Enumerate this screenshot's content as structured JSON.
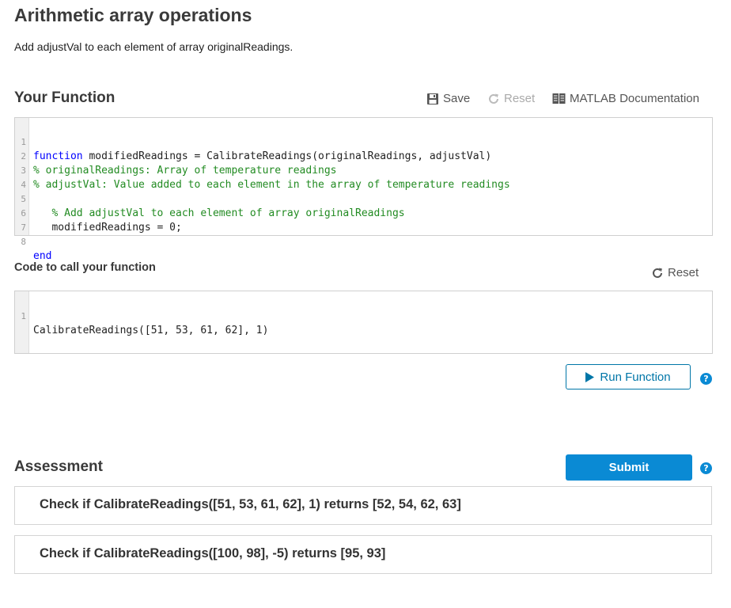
{
  "problem": {
    "title": "Arithmetic array operations",
    "description": "Add adjustVal to each element of array originalReadings."
  },
  "your_function": {
    "heading": "Your Function",
    "save_label": "Save",
    "reset_label": "Reset",
    "docs_label": "MATLAB Documentation",
    "line_numbers": [
      "1",
      "2",
      "3",
      "4",
      "5",
      "6",
      "7",
      "8"
    ],
    "lines": {
      "l1_kw": "function",
      "l1_rest": " modifiedReadings = CalibrateReadings(originalReadings, adjustVal)",
      "l2": "% originalReadings: Array of temperature readings",
      "l3": "% adjustVal: Value added to each element in the array of temperature readings",
      "l4": "",
      "l5": "   % Add adjustVal to each element of array originalReadings",
      "l6": "   modifiedReadings = 0;",
      "l7": "",
      "l8": "end"
    }
  },
  "call_code": {
    "heading": "Code to call your function",
    "reset_label": "Reset",
    "line_numbers": [
      "1"
    ],
    "line1": "CalibrateReadings([51, 53, 61, 62], 1)"
  },
  "run": {
    "label": "Run Function",
    "help": "?"
  },
  "assessment": {
    "heading": "Assessment",
    "submit_label": "Submit",
    "help": "?",
    "tests": [
      {
        "text": "Check if CalibrateReadings([51, 53, 61, 62], 1) returns [52, 54, 62, 63]"
      },
      {
        "text": "Check if CalibrateReadings([100, 98], -5) returns [95, 93]"
      }
    ]
  }
}
